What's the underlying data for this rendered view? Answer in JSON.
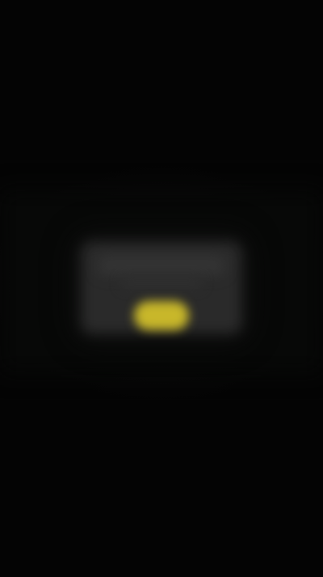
{
  "dialog": {
    "title": "",
    "message": "",
    "primary_button_label": ""
  },
  "colors": {
    "background": "#040404",
    "dialog_surface": "#2a2a2a",
    "accent": "#c8b72a"
  }
}
